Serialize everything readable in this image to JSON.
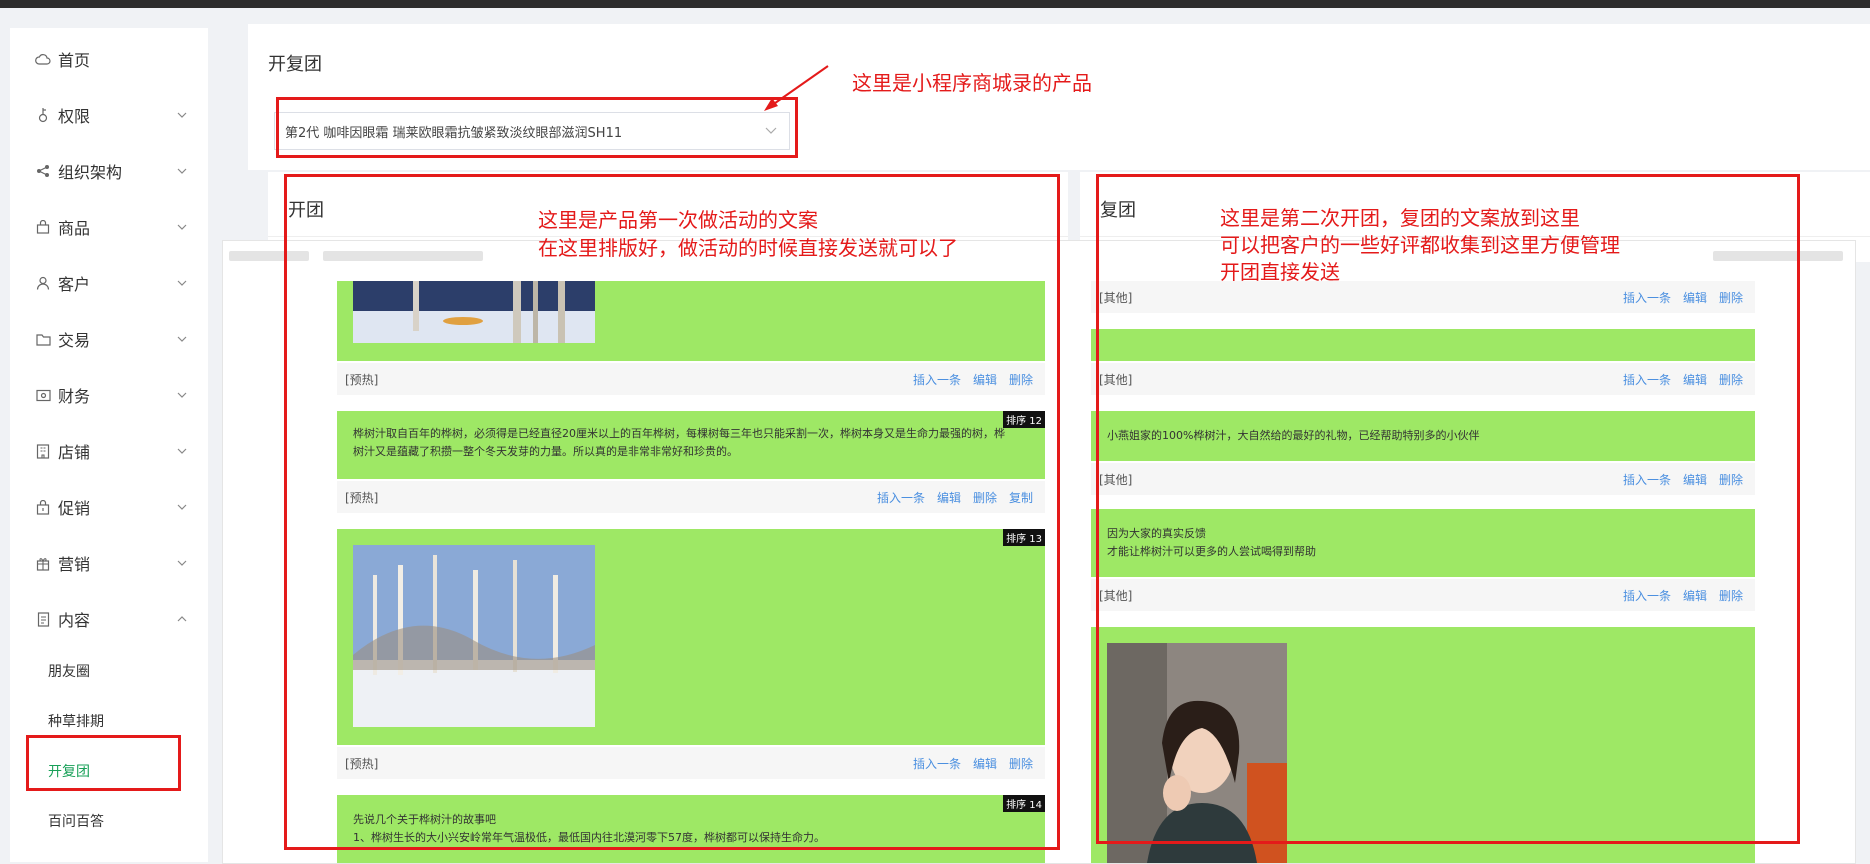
{
  "sidebar": {
    "items": [
      {
        "label": "首页",
        "icon": "cloud-icon"
      },
      {
        "label": "权限",
        "icon": "key-icon"
      },
      {
        "label": "组织架构",
        "icon": "share-icon"
      },
      {
        "label": "商品",
        "icon": "bag-icon"
      },
      {
        "label": "客户",
        "icon": "user-icon"
      },
      {
        "label": "交易",
        "icon": "folder-icon"
      },
      {
        "label": "财务",
        "icon": "wallet-icon"
      },
      {
        "label": "店铺",
        "icon": "building-icon"
      },
      {
        "label": "促销",
        "icon": "gift-bag-icon"
      },
      {
        "label": "营销",
        "icon": "gift-icon"
      },
      {
        "label": "内容",
        "icon": "document-icon"
      }
    ],
    "sub_items": [
      "朋友圈",
      "种草排期",
      "开复团",
      "百问百答"
    ],
    "active_sub": "开复团"
  },
  "page": {
    "title": "开复团",
    "product_select": "第2代  咖啡因眼霜  瑞莱欧眼霜抗皱紧致淡纹眼部滋润SH11"
  },
  "left_panel": {
    "title": "开团",
    "rows": [
      {
        "tag": "[预热]",
        "actions": [
          "插入一条",
          "编辑",
          "删除"
        ]
      },
      {
        "tag": "[预热]",
        "actions": [
          "插入一条",
          "编辑",
          "删除",
          "复制"
        ]
      },
      {
        "tag": "[预热]",
        "actions": [
          "插入一条",
          "编辑",
          "删除"
        ]
      }
    ],
    "badges": [
      "排序 12",
      "排序 13",
      "排序 14"
    ],
    "text1": "桦树汁取自百年的桦树，必须得是已经直径20厘米以上的百年桦树，每棵树每三年也只能采割一次，桦树本身又是生命力最强的树，桦",
    "text1b": "树汁又是蕴藏了积攒一整个冬天发芽的力量。所以真的是非常非常好和珍贵的。",
    "text2": "先说几个关于桦树汁的故事吧",
    "text3": "1、桦树生长的大小兴安岭常年气温极低，最低国内往北漠河零下57度，桦树都可以保持生命力。"
  },
  "right_panel": {
    "title": "复团",
    "rows": [
      {
        "tag": "[其他]",
        "actions": [
          "插入一条",
          "编辑",
          "删除"
        ]
      },
      {
        "tag": "[其他]",
        "actions": [
          "插入一条",
          "编辑",
          "删除"
        ]
      },
      {
        "tag": "[其他]",
        "actions": [
          "插入一条",
          "编辑",
          "删除"
        ]
      },
      {
        "tag": "[其他]",
        "actions": [
          "插入一条",
          "编辑",
          "删除"
        ]
      }
    ],
    "text1": "小燕姐家的100%桦树汁，大自然给的最好的礼物，已经帮助特别多的小伙伴",
    "text2": "因为大家的真实反馈",
    "text3": "才能让桦树汁可以更多的人尝试喝得到帮助"
  },
  "annotations": {
    "product": "这里是小程序商城录的产品",
    "left_1": "这里是产品第一次做活动的文案",
    "left_2": "在这里排版好，做活动的时候直接发送就可以了",
    "right_1": "这里是第二次开团，复团的文案放到这里",
    "right_2": "可以把客户的一些好评都收集到这里方便管理",
    "right_3": "开团直接发送"
  },
  "colors": {
    "annotation": "#e41a1a",
    "active": "#18a058",
    "card": "#9ee865",
    "link": "#4a8fe0"
  }
}
